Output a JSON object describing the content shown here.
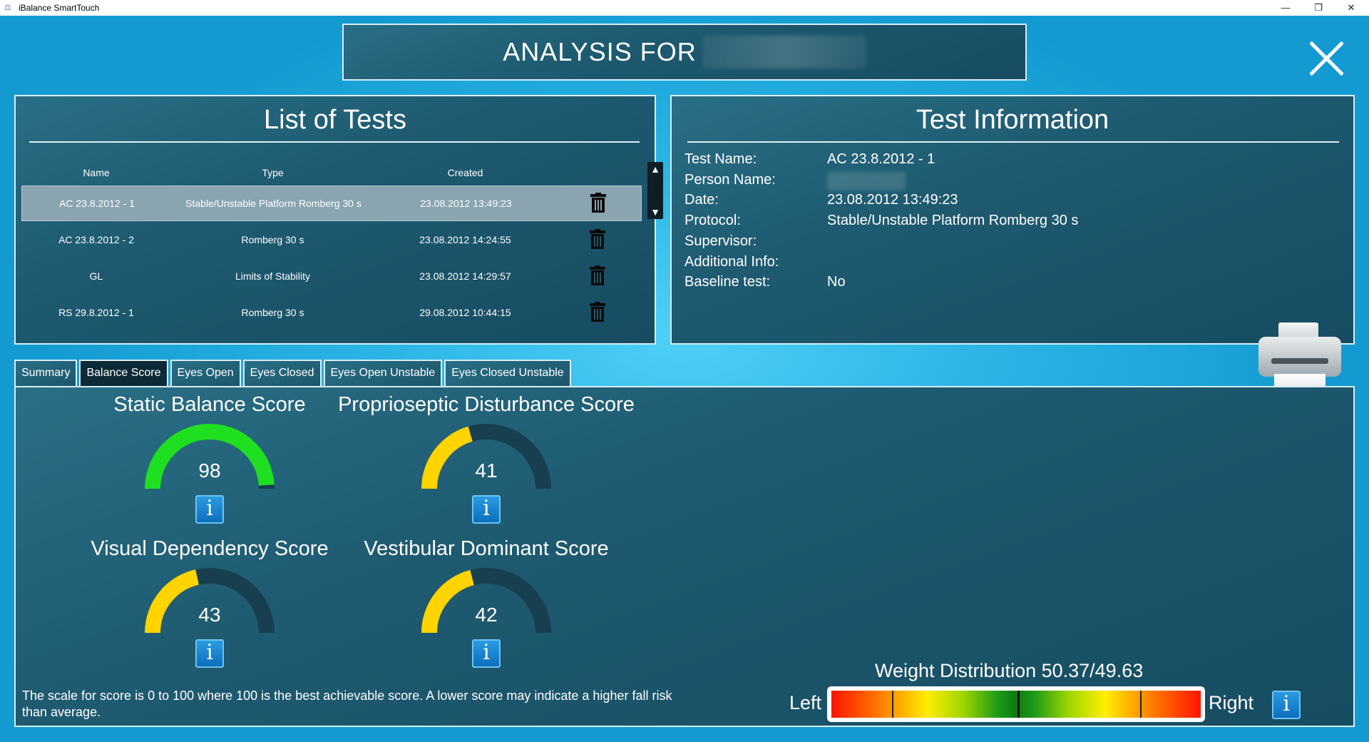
{
  "window": {
    "title": "iBalance SmartTouch",
    "controls": {
      "minimize": "—",
      "restore": "❐",
      "close": "✕"
    }
  },
  "header": {
    "title": "ANALYSIS FOR"
  },
  "tests_panel": {
    "title": "List of Tests",
    "columns": {
      "name": "Name",
      "type": "Type",
      "created": "Created"
    },
    "rows": [
      {
        "name": "AC 23.8.2012 - 1",
        "type": "Stable/Unstable Platform Romberg 30 s",
        "created": "23.08.2012 13:49:23",
        "selected": true
      },
      {
        "name": "AC 23.8.2012 - 2",
        "type": "Romberg 30 s",
        "created": "23.08.2012 14:24:55",
        "selected": false
      },
      {
        "name": "GL",
        "type": "Limits of Stability",
        "created": "23.08.2012 14:29:57",
        "selected": false
      },
      {
        "name": "RS 29.8.2012 - 1",
        "type": "Romberg 30 s",
        "created": "29.08.2012 10:44:15",
        "selected": false
      }
    ],
    "scroll": {
      "up": "▲",
      "down": "▼"
    }
  },
  "info_panel": {
    "title": "Test Information",
    "fields": [
      {
        "label": "Test Name:",
        "value": "AC 23.8.2012 - 1"
      },
      {
        "label": "Person Name:",
        "value": ""
      },
      {
        "label": "Date:",
        "value": "23.08.2012 13:49:23"
      },
      {
        "label": "Protocol:",
        "value": "Stable/Unstable Platform Romberg 30 s"
      },
      {
        "label": "Supervisor:",
        "value": ""
      },
      {
        "label": "Additional Info:",
        "value": ""
      },
      {
        "label": "Baseline test:",
        "value": "No"
      }
    ]
  },
  "tabs": [
    {
      "label": "Summary",
      "active": false
    },
    {
      "label": "Balance Score",
      "active": true
    },
    {
      "label": "Eyes Open",
      "active": false
    },
    {
      "label": "Eyes Closed",
      "active": false
    },
    {
      "label": "Eyes Open Unstable",
      "active": false
    },
    {
      "label": "Eyes Closed Unstable",
      "active": false
    }
  ],
  "scores": [
    {
      "title": "Static Balance Score",
      "value": 98,
      "color": "#1fe020"
    },
    {
      "title": "Proprioseptic Disturbance Score",
      "value": 41,
      "color": "#ffd400"
    },
    {
      "title": "Visual Dependency Score",
      "value": 43,
      "color": "#ffd400"
    },
    {
      "title": "Vestibular Dominant Score",
      "value": 42,
      "color": "#ffd400"
    }
  ],
  "info_button_label": "i",
  "scale_note": "The scale for score is 0 to 100 where 100 is the best achievable score. A lower score may indicate a higher fall risk than average.",
  "weight_distribution": {
    "title": "Weight Distribution 50.37/49.63",
    "left_label": "Left",
    "right_label": "Right",
    "left_percent": 50.37,
    "right_percent": 49.63
  },
  "colors": {
    "gauge_track": "#173f50",
    "panel_border": "#d7eef7",
    "selected_row": "#8aa4b0"
  }
}
